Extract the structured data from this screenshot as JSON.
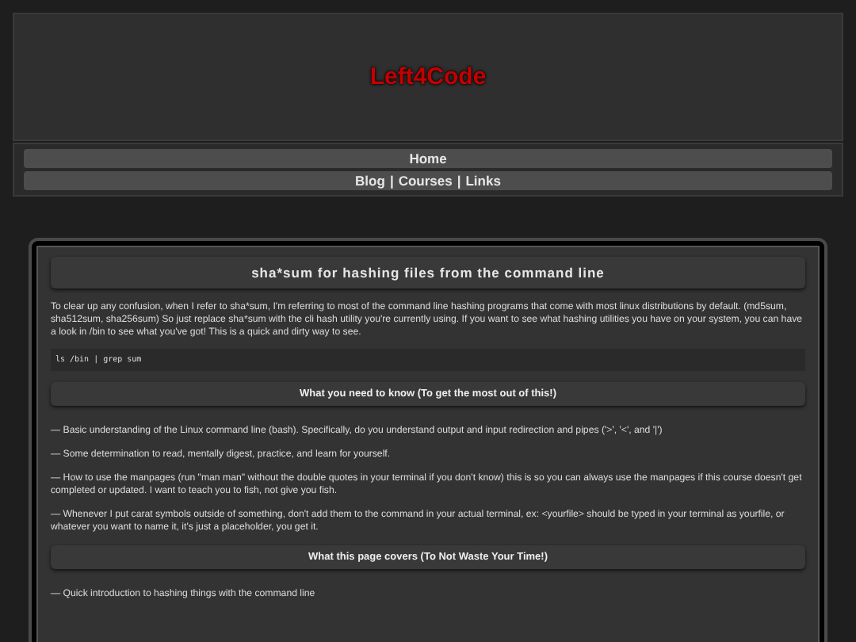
{
  "site_title": "Left4Code",
  "nav": [
    {
      "items": [
        "Home"
      ]
    },
    {
      "items": [
        "Blog",
        "Courses",
        "Links"
      ],
      "separator": "|"
    }
  ],
  "article": {
    "title": "sha*sum for hashing files from the command line",
    "intro": "To clear up any confusion, when I refer to sha*sum, I'm referring to most of the command line hashing programs that come with most linux distributions by default. (md5sum, sha512sum, sha256sum) So just replace sha*sum with the cli hash utility you're currently using. If you want to see what hashing utilities you have on your system, you can have a look in /bin to see what you've got! This is a quick and dirty way to see.",
    "code": "ls /bin | grep sum",
    "sections": [
      {
        "heading": "What you need to know (To get the most out of this!)",
        "items": [
          "— Basic understanding of the Linux command line (bash). Specifically, do you understand output and input redirection and pipes ('>', '<', and '|')",
          "—  Some determination to read, mentally digest, practice, and learn for yourself.",
          "—  How to use the manpages (run \"man man\" without the double quotes in your terminal if you don't know) this is so you can always use the manpages if this course doesn't get completed or updated. I want to teach you to fish, not give you fish.",
          "—  Whenever I put carat symbols outside of something, don't add them to the command in your actual terminal, ex: <yourfile> should be typed in your terminal as yourfile, or whatever you want to name it, it's just a placeholder, you get it."
        ]
      },
      {
        "heading": "What this page covers (To Not Waste Your Time!)",
        "items": [
          "— Quick introduction to hashing things with the command line"
        ]
      }
    ]
  }
}
